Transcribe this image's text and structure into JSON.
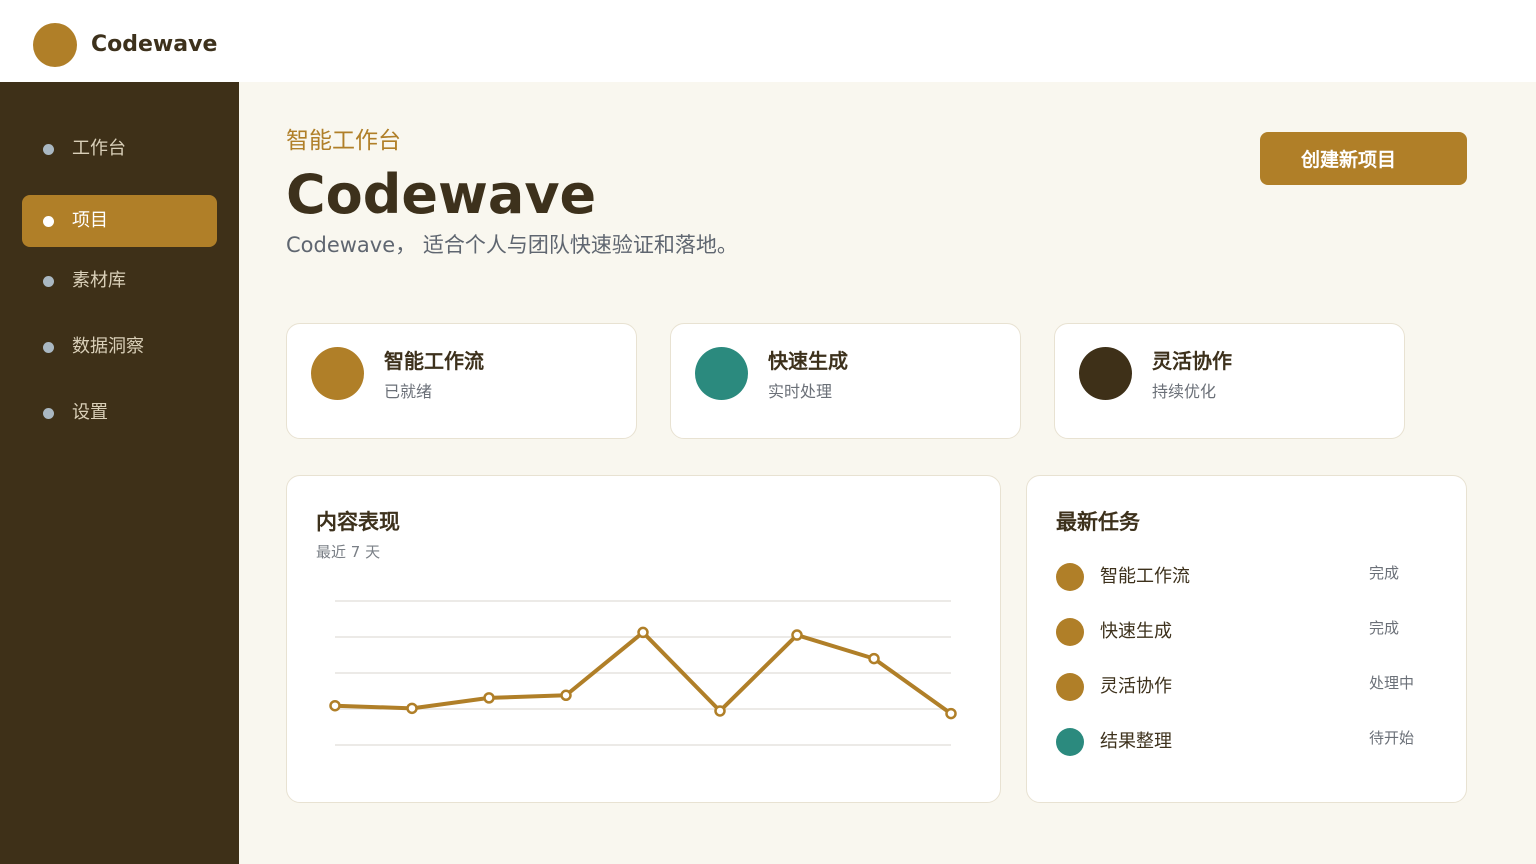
{
  "app": {
    "brand": "Codewave"
  },
  "colors": {
    "accent": "#b07f28",
    "teal": "#2b8a7e",
    "dark": "#3e3018"
  },
  "sidebar": {
    "items": [
      {
        "label": "工作台",
        "active": false
      },
      {
        "label": "项目",
        "active": true
      },
      {
        "label": "素材库",
        "active": false
      },
      {
        "label": "数据洞察",
        "active": false
      },
      {
        "label": "设置",
        "active": false
      }
    ]
  },
  "hero": {
    "eyebrow": "智能工作台",
    "title": "Codewave",
    "subtitle": "Codewave， 适合个人与团队快速验证和落地。",
    "cta_label": "创建新项目"
  },
  "features": [
    {
      "title": "智能工作流",
      "subtitle": "已就绪",
      "color": "#b07f28"
    },
    {
      "title": "快速生成",
      "subtitle": "实时处理",
      "color": "#2b8a7e"
    },
    {
      "title": "灵活协作",
      "subtitle": "持续优化",
      "color": "#3e3018"
    }
  ],
  "content_panel": {
    "title": "内容表现",
    "subtitle": "最近 7 天"
  },
  "chart_data": {
    "type": "line",
    "x": [
      1,
      2,
      3,
      4,
      5,
      6,
      7,
      8,
      9
    ],
    "values": [
      30,
      28,
      36,
      38,
      86,
      26,
      84,
      66,
      24
    ],
    "ylim": [
      0,
      110
    ],
    "gridlines": 5,
    "color": "#b07f28",
    "title": "",
    "xlabel": "",
    "ylabel": ""
  },
  "tasks_panel": {
    "title": "最新任务",
    "items": [
      {
        "name": "智能工作流",
        "status": "完成",
        "color": "#b07f28"
      },
      {
        "name": "快速生成",
        "status": "完成",
        "color": "#b07f28"
      },
      {
        "name": "灵活协作",
        "status": "处理中",
        "color": "#b07f28"
      },
      {
        "name": "结果整理",
        "status": "待开始",
        "color": "#2b8a7e"
      }
    ]
  }
}
